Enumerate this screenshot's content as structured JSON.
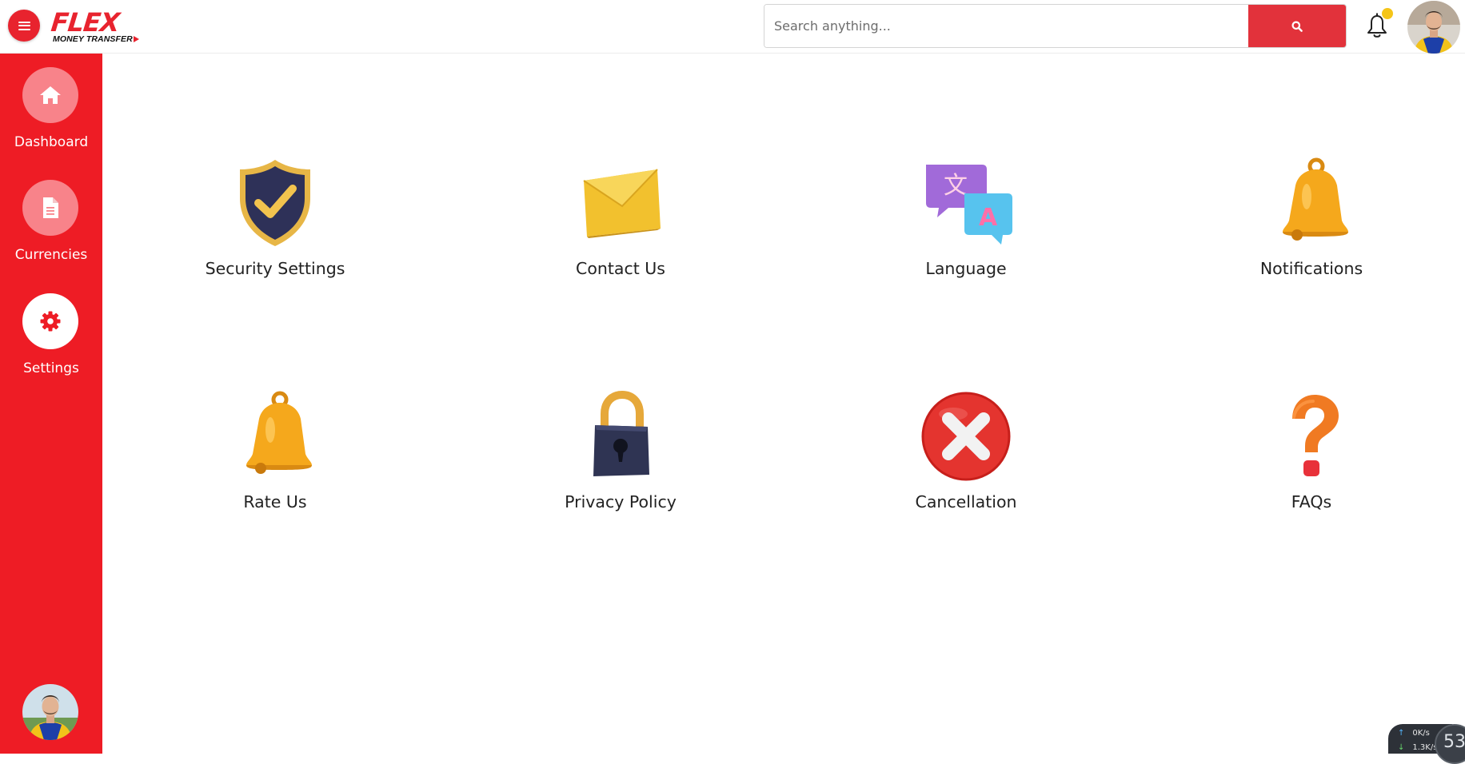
{
  "app": {
    "logo_main": "FLEX",
    "logo_sub": "MONEY TRANSFER"
  },
  "search": {
    "placeholder": "Search anything..."
  },
  "header": {
    "notification_dot_color": "#f5c518"
  },
  "sidebar": {
    "items": [
      {
        "label": "Dashboard",
        "icon": "home-icon"
      },
      {
        "label": "Currencies",
        "icon": "document-icon"
      },
      {
        "label": "Settings",
        "icon": "gear-icon",
        "active": true
      }
    ]
  },
  "settings": {
    "tiles": [
      {
        "label": "Security Settings",
        "icon": "shield-check-icon"
      },
      {
        "label": "Contact Us",
        "icon": "envelope-icon"
      },
      {
        "label": "Language",
        "icon": "translate-bubbles-icon"
      },
      {
        "label": "Notifications",
        "icon": "bell-icon"
      },
      {
        "label": "Rate Us",
        "icon": "bell-icon"
      },
      {
        "label": "Privacy Policy",
        "icon": "padlock-icon"
      },
      {
        "label": "Cancellation",
        "icon": "cancel-x-icon"
      },
      {
        "label": "FAQs",
        "icon": "question-mark-icon"
      }
    ]
  },
  "system_widget": {
    "upload": "0K/s",
    "download": "1.3K/s",
    "gauge": "53"
  },
  "colors": {
    "brand_red": "#ee1c25",
    "search_button": "#e2323b",
    "nav_circle": "#f8838a"
  }
}
